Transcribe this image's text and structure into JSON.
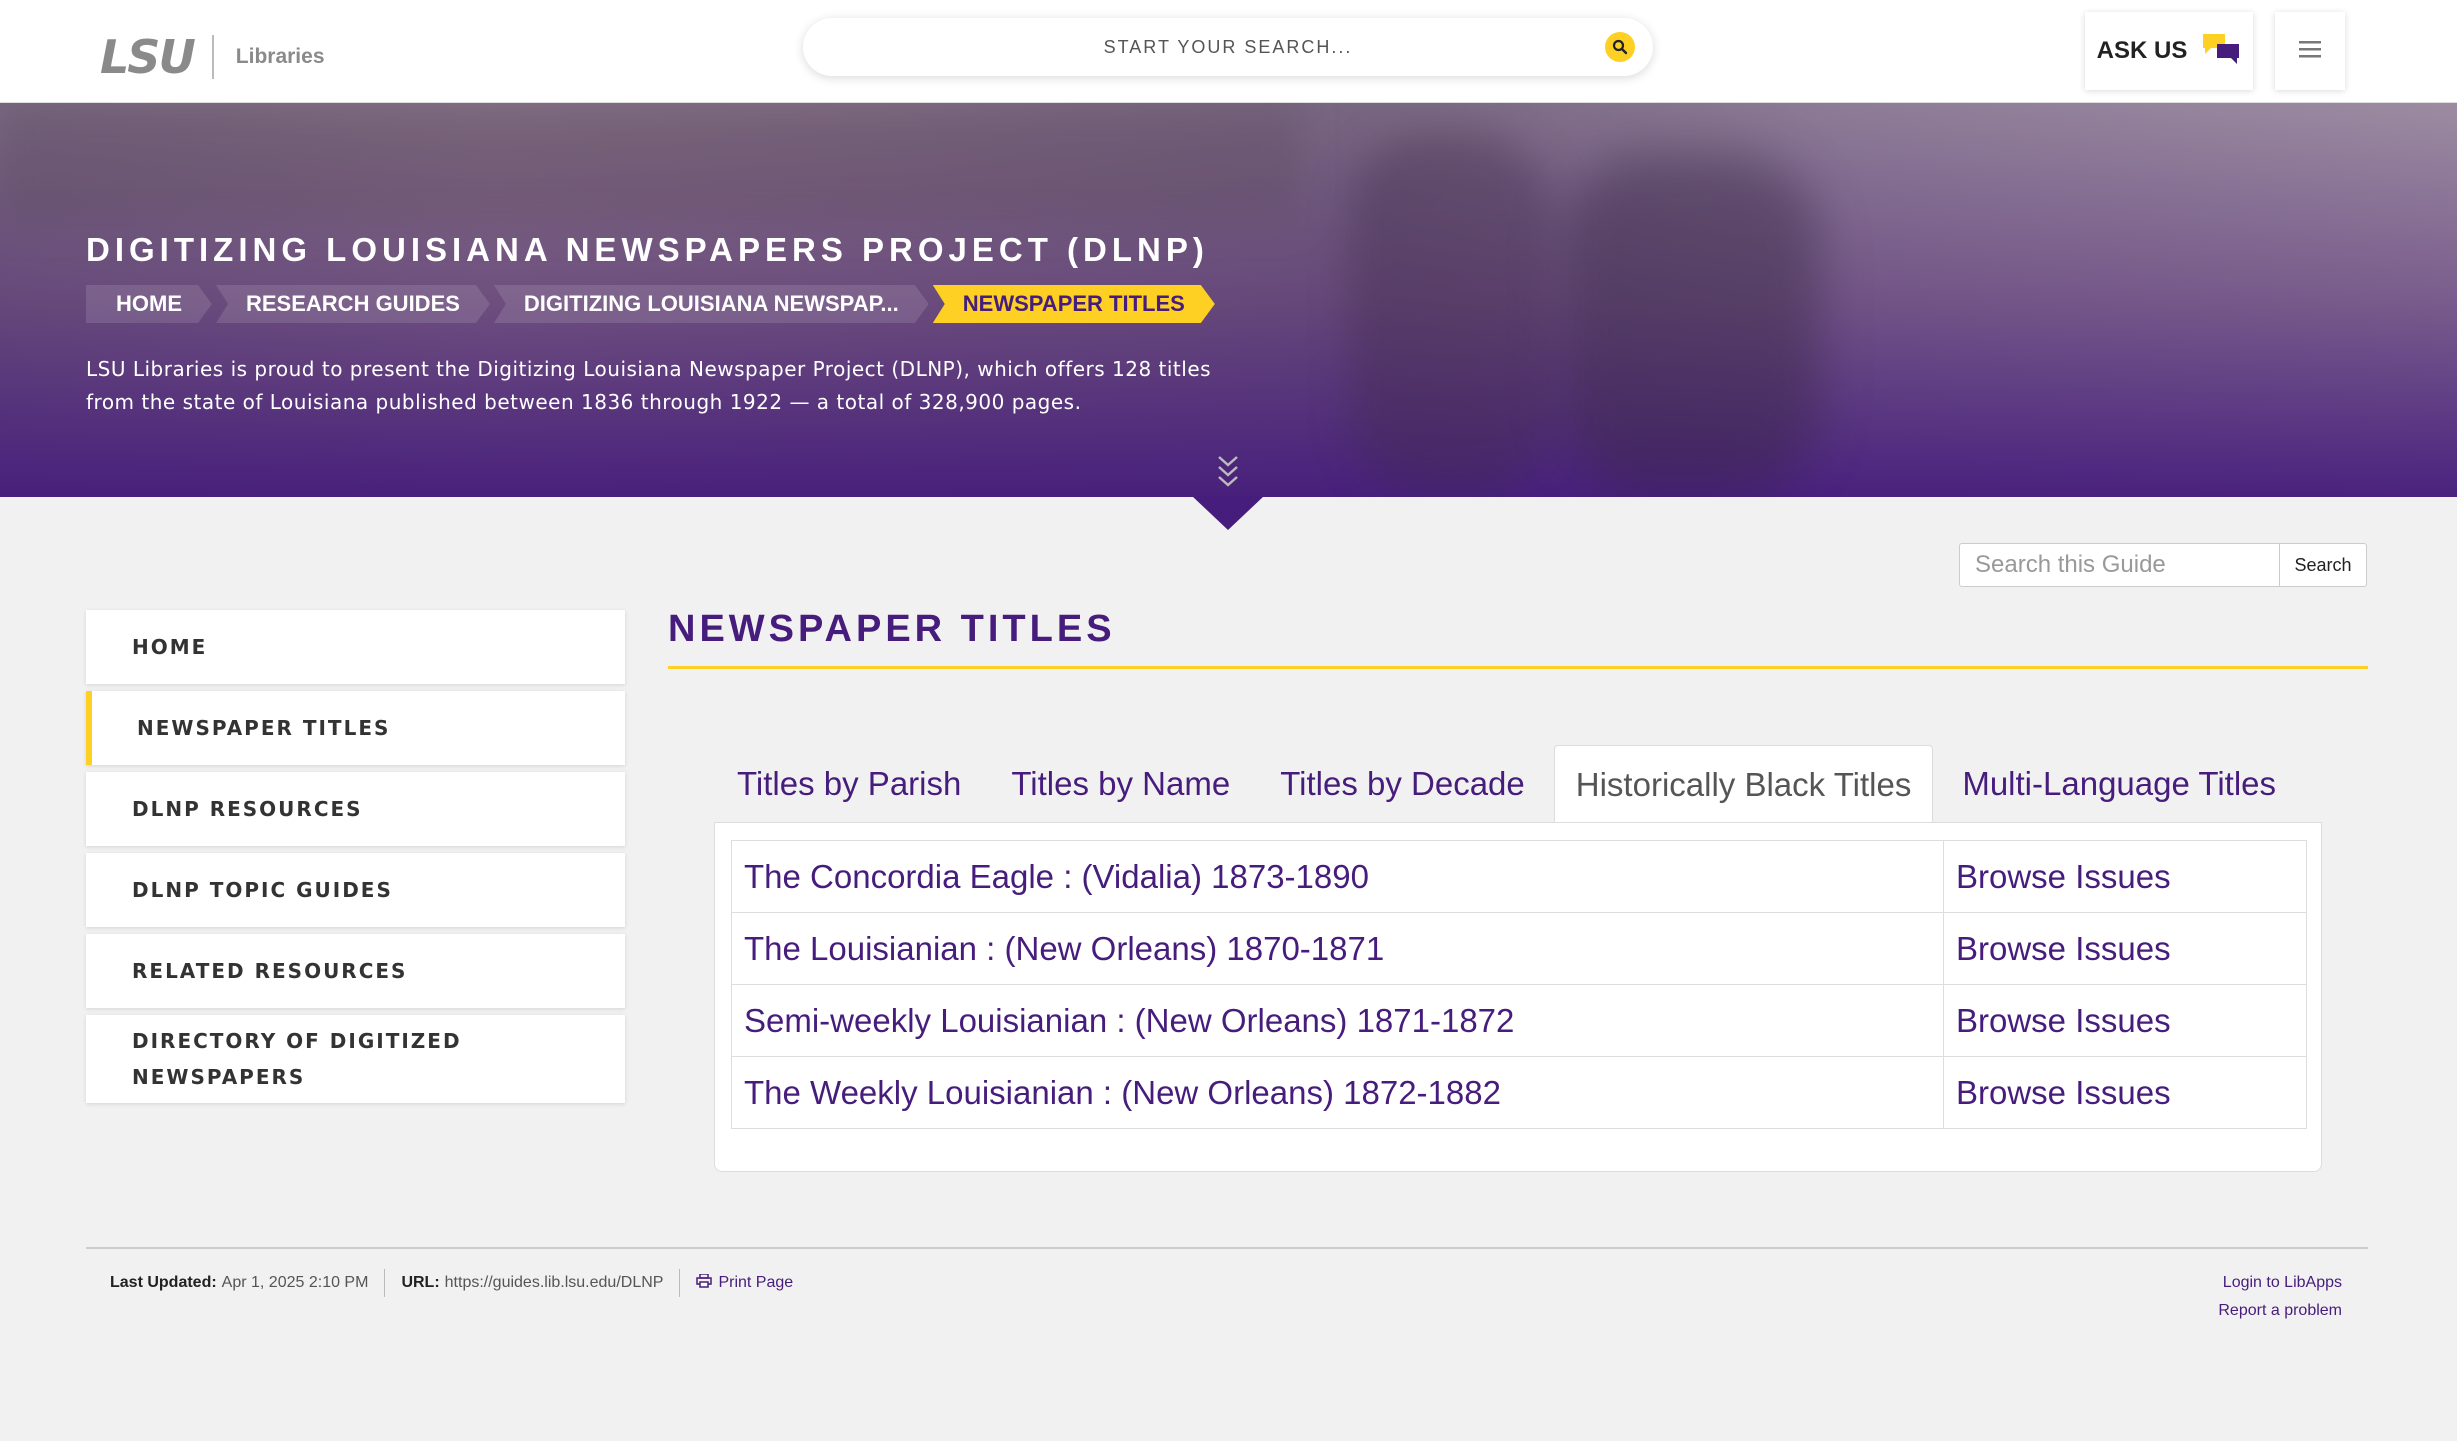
{
  "header": {
    "logo_lsu": "LSU",
    "logo_libraries": "Libraries",
    "search_placeholder": "START YOUR SEARCH...",
    "ask_us": "ASK US"
  },
  "hero": {
    "title": "DIGITIZING LOUISIANA NEWSPAPERS PROJECT (DLNP)",
    "breadcrumb": [
      "HOME",
      "RESEARCH GUIDES",
      "DIGITIZING LOUISIANA NEWSPAP...",
      "NEWSPAPER TITLES"
    ],
    "description_line1": "LSU Libraries is proud to present the Digitizing Louisiana Newspaper Project (DLNP), which offers 128 titles",
    "description_line2": "from the state of Louisiana published between 1836 through 1922 — a total of 328,900 pages."
  },
  "guide_search": {
    "placeholder": "Search this Guide",
    "button": "Search"
  },
  "sidenav": {
    "items": [
      {
        "label": "HOME"
      },
      {
        "label": "NEWSPAPER TITLES"
      },
      {
        "label": "DLNP RESOURCES"
      },
      {
        "label": "DLNP TOPIC GUIDES"
      },
      {
        "label": "RELATED RESOURCES"
      },
      {
        "label_line1": "DIRECTORY OF DIGITIZED",
        "label_line2": "NEWSPAPERS"
      }
    ]
  },
  "main": {
    "title": "NEWSPAPER TITLES",
    "tabs": [
      {
        "label": "Titles by Parish"
      },
      {
        "label": "Titles by Name"
      },
      {
        "label": "Titles by Decade"
      },
      {
        "label": "Historically Black Titles"
      },
      {
        "label": "Multi-Language Titles"
      }
    ],
    "rows": [
      {
        "title": "The Concordia Eagle : (Vidalia) 1873-1890",
        "action": "Browse Issues"
      },
      {
        "title": "The Louisianian : (New Orleans) 1870-1871",
        "action": "Browse Issues"
      },
      {
        "title": "Semi-weekly Louisianian : (New Orleans) 1871-1872",
        "action": "Browse Issues"
      },
      {
        "title": "The Weekly Louisianian : (New Orleans) 1872-1882",
        "action": "Browse Issues"
      }
    ]
  },
  "footer": {
    "last_updated_label": "Last Updated:",
    "last_updated_value": "Apr 1, 2025 2:10 PM",
    "url_label": "URL:",
    "url_value": "https://guides.lib.lsu.edu/DLNP",
    "print_page": "Print Page",
    "login": "Login to LibApps",
    "report": "Report a problem"
  },
  "colors": {
    "purple": "#461d7c",
    "gold": "#fdd023"
  }
}
